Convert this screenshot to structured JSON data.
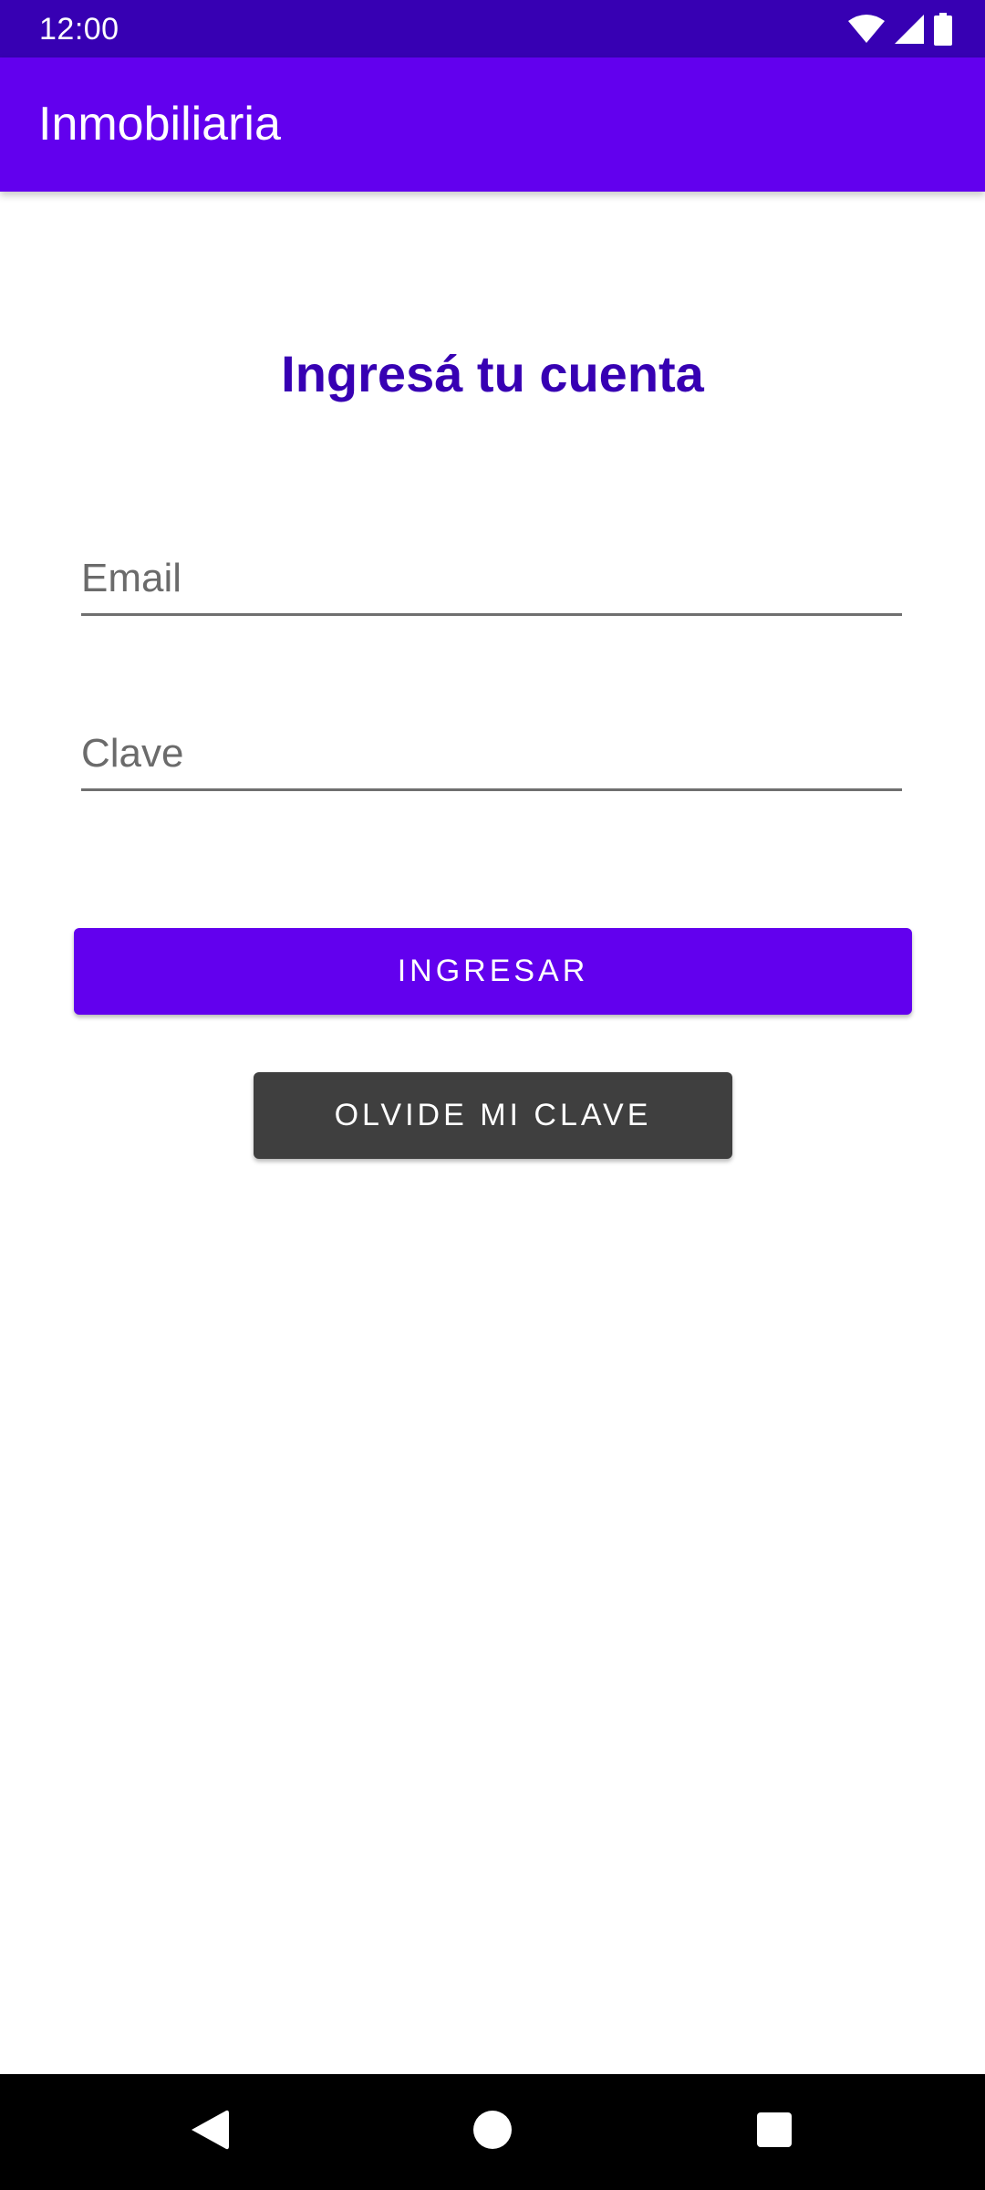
{
  "status_bar": {
    "time": "12:00",
    "icons": [
      "wifi-icon",
      "cell-signal-icon",
      "battery-icon"
    ]
  },
  "app_bar": {
    "title": "Inmobiliaria"
  },
  "login": {
    "heading": "Ingresá tu cuenta",
    "email_placeholder": "Email",
    "email_value": "",
    "password_placeholder": "Clave",
    "password_value": "",
    "login_button": "INGRESAR",
    "forgot_button": "OLVIDE MI CLAVE"
  },
  "nav_bar": {
    "icons": [
      "back-icon",
      "home-icon",
      "recents-icon"
    ]
  },
  "colors": {
    "status_bar": "#3700b3",
    "primary": "#6200ee",
    "heading": "#3700b3",
    "secondary_button": "#3f3f3f"
  }
}
